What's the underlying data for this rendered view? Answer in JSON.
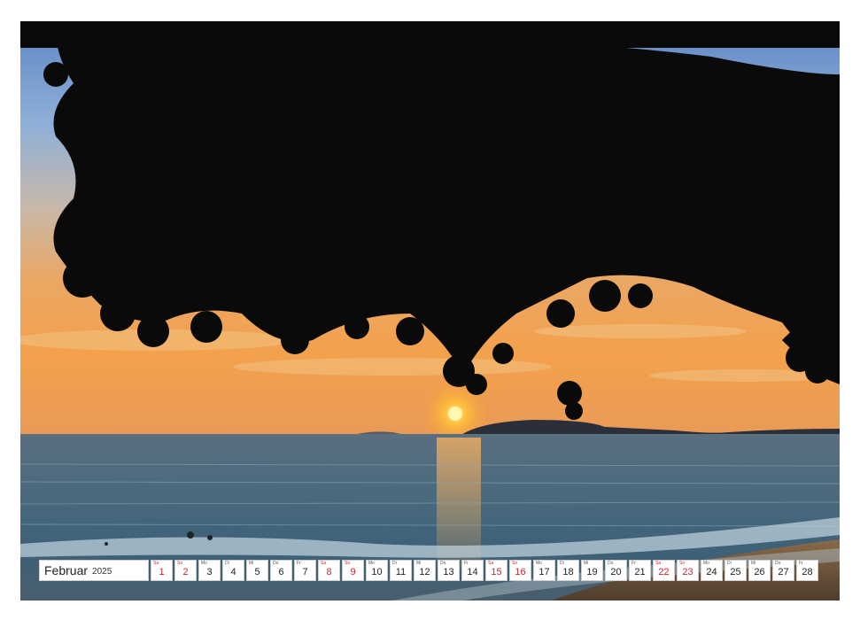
{
  "calendar": {
    "month": "Februar",
    "year": "2025",
    "days": [
      {
        "wd": "Sa",
        "num": "1",
        "red": true
      },
      {
        "wd": "So",
        "num": "2",
        "red": true
      },
      {
        "wd": "Mo",
        "num": "3",
        "red": false
      },
      {
        "wd": "Di",
        "num": "4",
        "red": false
      },
      {
        "wd": "Mi",
        "num": "5",
        "red": false
      },
      {
        "wd": "Do",
        "num": "6",
        "red": false
      },
      {
        "wd": "Fr",
        "num": "7",
        "red": false
      },
      {
        "wd": "Sa",
        "num": "8",
        "red": true
      },
      {
        "wd": "So",
        "num": "9",
        "red": true
      },
      {
        "wd": "Mo",
        "num": "10",
        "red": false
      },
      {
        "wd": "Di",
        "num": "11",
        "red": false
      },
      {
        "wd": "Mi",
        "num": "12",
        "red": false
      },
      {
        "wd": "Do",
        "num": "13",
        "red": false
      },
      {
        "wd": "Fr",
        "num": "14",
        "red": false
      },
      {
        "wd": "Sa",
        "num": "15",
        "red": true
      },
      {
        "wd": "So",
        "num": "16",
        "red": true
      },
      {
        "wd": "Mo",
        "num": "17",
        "red": false
      },
      {
        "wd": "Di",
        "num": "18",
        "red": false
      },
      {
        "wd": "Mi",
        "num": "19",
        "red": false
      },
      {
        "wd": "Do",
        "num": "20",
        "red": false
      },
      {
        "wd": "Fr",
        "num": "21",
        "red": false
      },
      {
        "wd": "Sa",
        "num": "22",
        "red": true
      },
      {
        "wd": "So",
        "num": "23",
        "red": true
      },
      {
        "wd": "Mo",
        "num": "24",
        "red": false
      },
      {
        "wd": "Di",
        "num": "25",
        "red": false
      },
      {
        "wd": "Mi",
        "num": "26",
        "red": false
      },
      {
        "wd": "Do",
        "num": "27",
        "red": false
      },
      {
        "wd": "Fr",
        "num": "28",
        "red": false
      }
    ]
  },
  "colors": {
    "weekend": "#d2232a",
    "text": "#222222"
  },
  "icons": [
    "binding-holes-icon",
    "sun-icon",
    "tree-silhouette-icon"
  ]
}
